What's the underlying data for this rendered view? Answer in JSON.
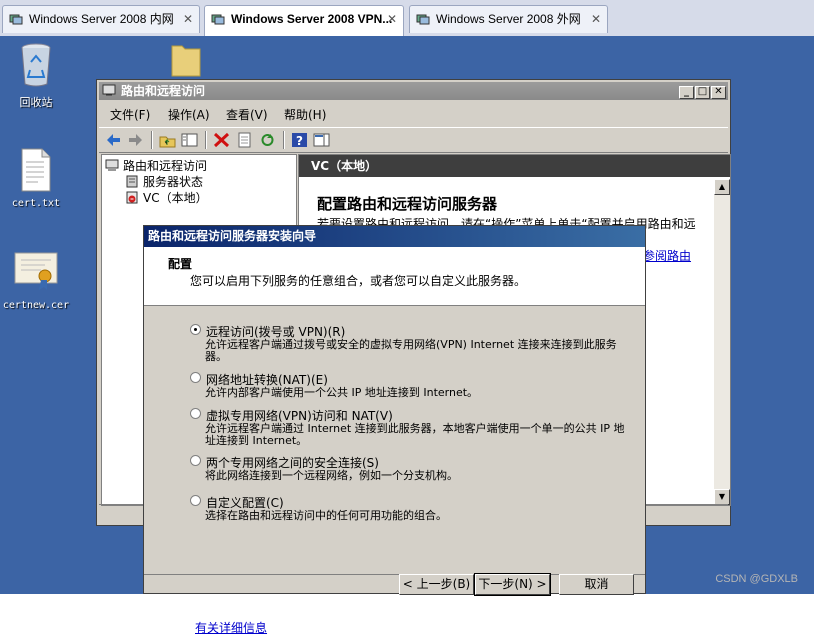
{
  "vm_tabs": [
    {
      "label": "Windows Server 2008 内网",
      "close": "✕"
    },
    {
      "label": "Windows Server 2008 VPN...",
      "close": "✕"
    },
    {
      "label": "Windows Server 2008 外网",
      "close": "✕"
    }
  ],
  "desktop": {
    "icons": [
      {
        "label": "回收站"
      },
      {
        "label": "cert.txt"
      },
      {
        "label": "certnew.cer"
      }
    ]
  },
  "mmc": {
    "title": "路由和远程访问",
    "window_buttons": [
      "_",
      "□",
      "✕"
    ],
    "menu": [
      "文件(F)",
      "操作(A)",
      "查看(V)",
      "帮助(H)"
    ],
    "tree": [
      "路由和远程访问",
      "服务器状态",
      "VC（本地）"
    ],
    "right_header": "VC（本地）",
    "right_title": "配置路由和远程访问服务器",
    "right_desc": "若要设置路由和远程访问，请在“操作”菜单上单击“配置并启用路由和远程访问”。有关设置的详细信息，请参阅帮助。",
    "right_link": "请参阅路由"
  },
  "wizard": {
    "title": "路由和远程访问服务器安装向导",
    "header_title": "配置",
    "header_desc": "您可以启用下列服务的任意组合，或者您可以自定义此服务器。",
    "options": [
      {
        "label": "远程访问(拨号或 VPN)(R)",
        "desc": "允许远程客户端通过拨号或安全的虚拟专用网络(VPN) Internet 连接来连接到此服务器。",
        "selected": true
      },
      {
        "label": "网络地址转换(NAT)(E)",
        "desc": "允许内部客户端使用一个公共 IP 地址连接到 Internet。",
        "selected": false
      },
      {
        "label": "虚拟专用网络(VPN)访问和 NAT(V)",
        "desc": "允许远程客户端通过 Internet 连接到此服务器，本地客户端使用一个单一的公共 IP 地址连接到 Internet。",
        "selected": false
      },
      {
        "label": "两个专用网络之间的安全连接(S)",
        "desc": "将此网络连接到一个远程网络，例如一个分支机构。",
        "selected": false
      },
      {
        "label": "自定义配置(C)",
        "desc": "选择在路由和远程访问中的任何可用功能的组合。",
        "selected": false
      }
    ],
    "more_info": "有关详细信息",
    "buttons": {
      "back": "< 上一步(B)",
      "next": "下一步(N) >",
      "cancel": "取消"
    }
  },
  "watermark": "CSDN @GDXLB"
}
